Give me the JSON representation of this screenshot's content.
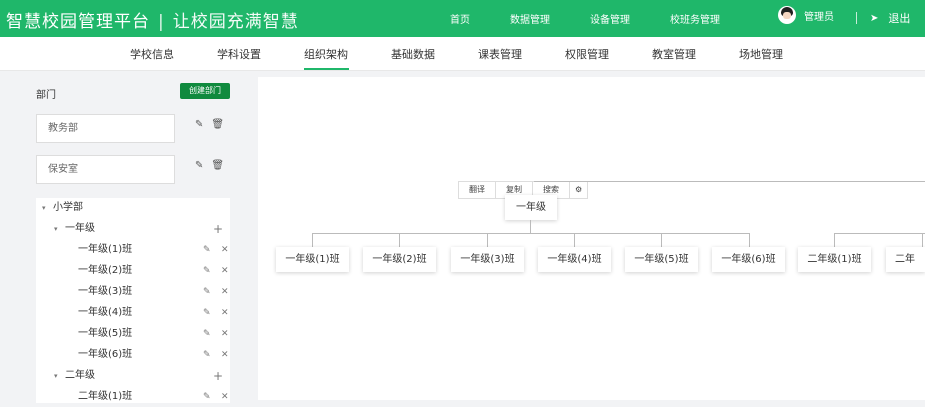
{
  "topbar": {
    "brand": "智慧校园管理平台",
    "separator": "|",
    "slogan": "让校园充满智慧",
    "nav": [
      "首页",
      "数据管理",
      "设备管理",
      "校班务管理"
    ],
    "user": "管理员",
    "logout": "退出",
    "colors": {
      "primary": "#1fb76a",
      "button": "#108a3e"
    }
  },
  "subnav": {
    "tabs": [
      "学校信息",
      "学科设置",
      "组织架构",
      "基础数据",
      "课表管理",
      "权限管理",
      "教室管理",
      "场地管理"
    ],
    "active": "组织架构"
  },
  "sidebar": {
    "title": "部门",
    "create_button": "创建部门",
    "departments": [
      "教务部",
      "保安室"
    ],
    "tree": {
      "root": "小学部",
      "grade1": "一年级",
      "classes": [
        "一年级(1)班",
        "一年级(2)班",
        "一年级(3)班",
        "一年级(4)班",
        "一年级(5)班",
        "一年级(6)班"
      ],
      "grade2": "二年级",
      "grade2_class1": "二年级(1)班"
    }
  },
  "chart": {
    "toolbar": [
      "翻译",
      "复制",
      "搜索"
    ],
    "settings_icon": "gear-icon",
    "root_node": "一年级",
    "children": [
      "一年级(1)班",
      "一年级(2)班",
      "一年级(3)班",
      "一年级(4)班",
      "一年级(5)班",
      "一年级(6)班",
      "二年级(1)班",
      "二年"
    ]
  }
}
